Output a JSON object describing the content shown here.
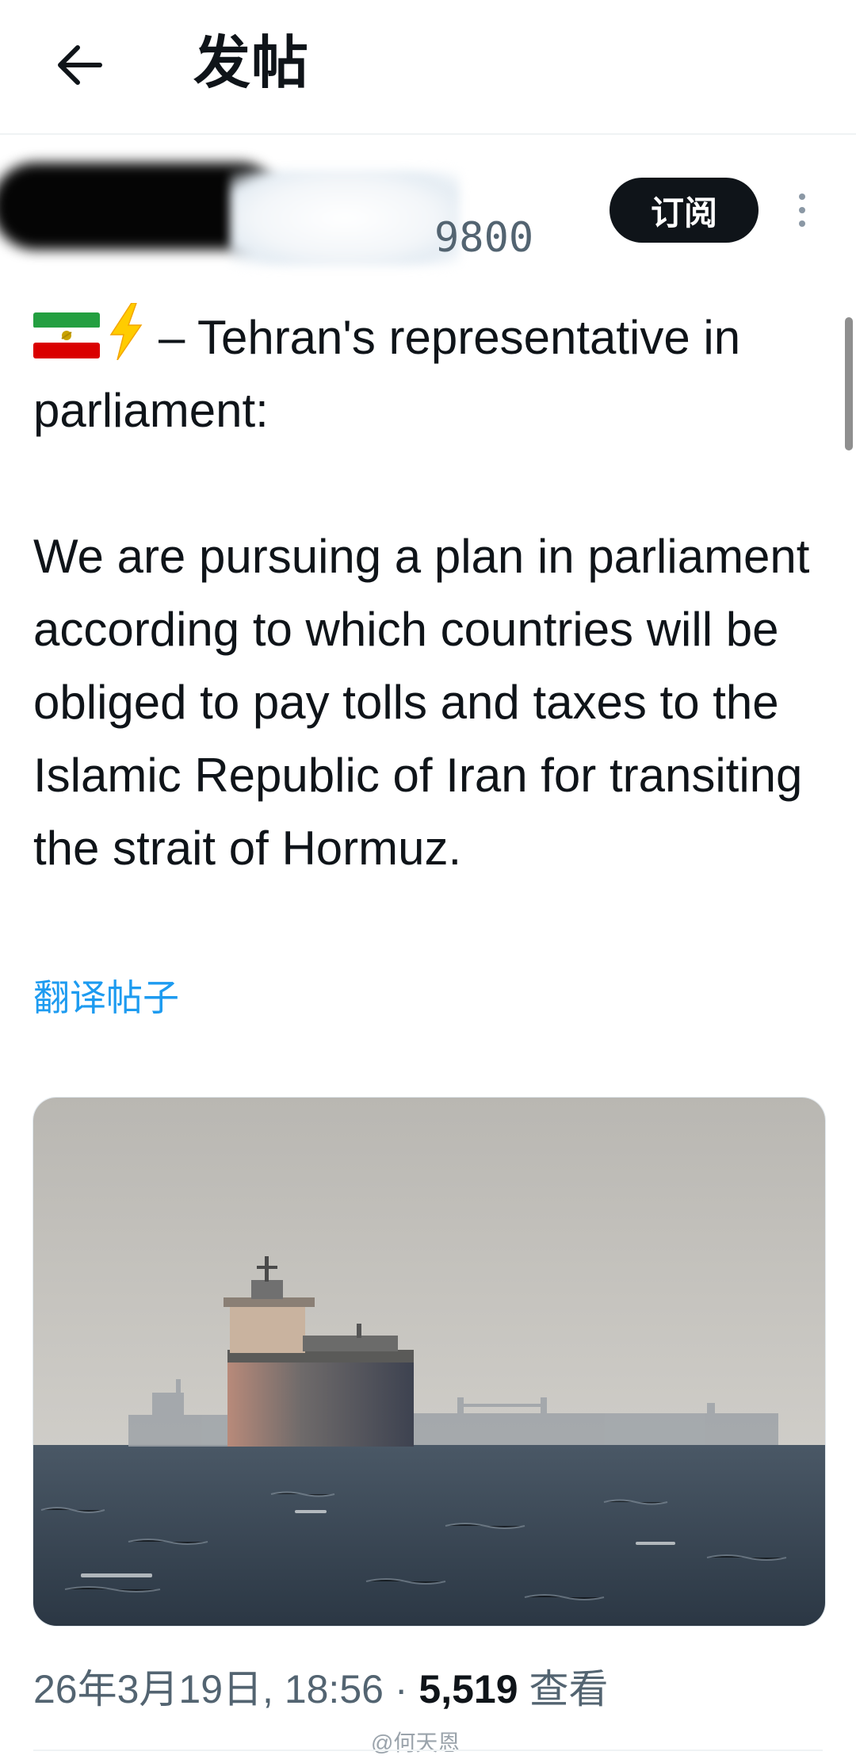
{
  "header": {
    "title": "发帖",
    "back_icon": "arrow-left-icon"
  },
  "author": {
    "handle_visible_tail": "9800",
    "subscribe_label": "订阅",
    "more_icon": "more-vertical-icon"
  },
  "post": {
    "emoji": [
      "iran-flag-icon",
      "lightning-bolt-icon"
    ],
    "line1": "– Tehran's representative in parliament:",
    "paragraph2": "We are pursuing a plan in parliament according to which countries will be obliged to pay tolls and taxes to the Islamic Republic of Iran for transiting the strait of Hormuz.",
    "translate_label": "翻译帖子"
  },
  "meta": {
    "date": "26年3月19日, 18:56",
    "separator": "·",
    "views_count": "5,519",
    "views_label": "查看"
  },
  "watermark": "@何天恩",
  "colors": {
    "link": "#1d9bf0",
    "subscribe_bg": "#0f1419",
    "muted": "#536471"
  }
}
